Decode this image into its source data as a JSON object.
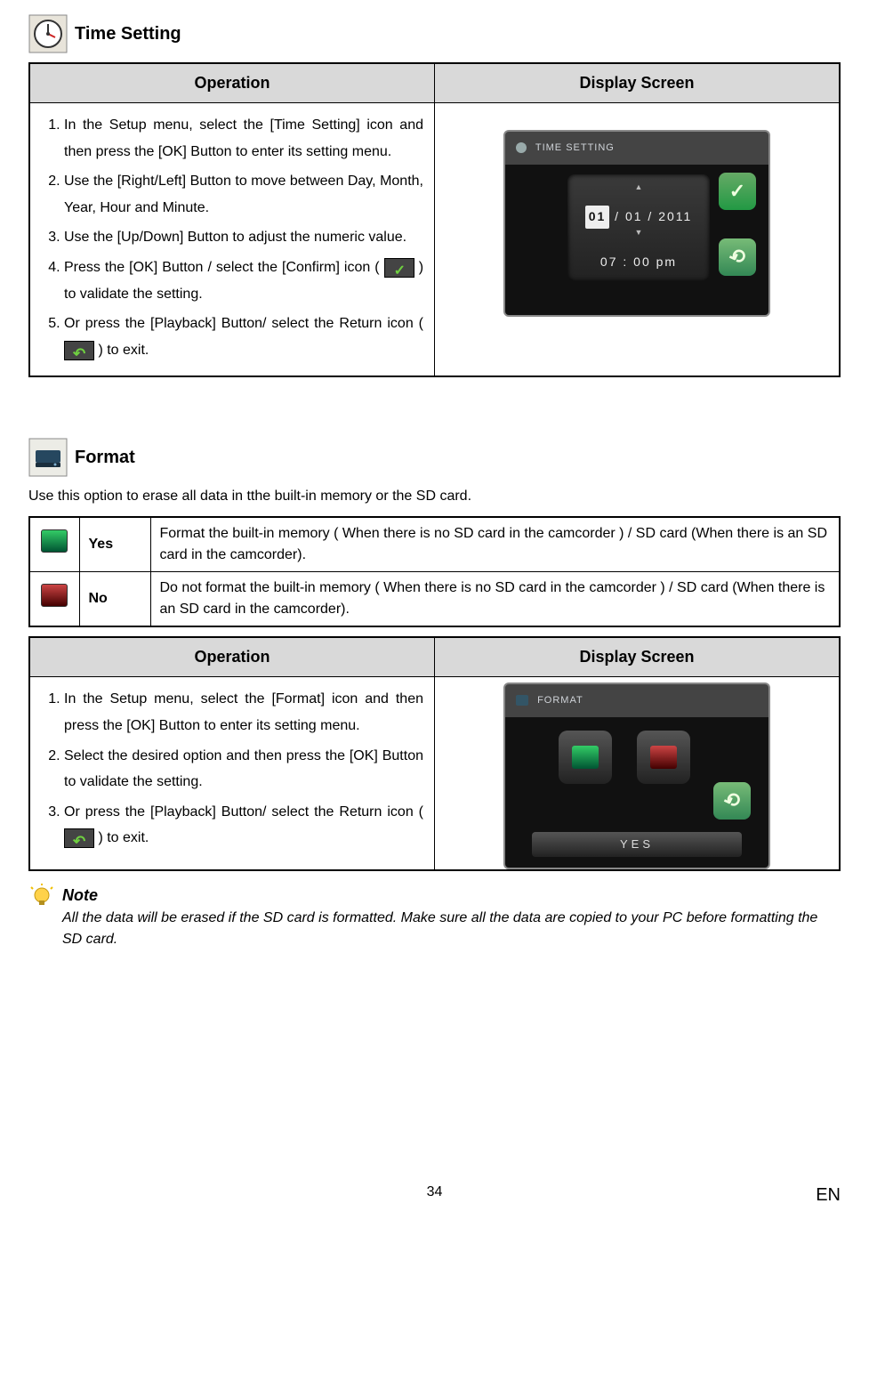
{
  "time_setting": {
    "heading": "Time Setting",
    "table": {
      "col_operation": "Operation",
      "col_display": "Display Screen",
      "steps": {
        "s1": "In the Setup menu, select the [Time Setting] icon and then press the [OK] Button to enter its setting menu.",
        "s2": "Use the [Right/Left] Button to move between Day, Month, Year, Hour and Minute.",
        "s3": "Use the [Up/Down] Button to adjust the numeric value.",
        "s4a": "Press the [OK] Button / select the [Confirm] icon (",
        "s4b": ") to validate the setting.",
        "s5a": "Or press the [Playback] Button/ select the Return icon (",
        "s5b": ") to exit."
      }
    },
    "screen": {
      "title": "TIME SETTING",
      "day": "01",
      "month": "01",
      "year": "2011",
      "hour": "07",
      "minute": "00",
      "ampm": "pm"
    }
  },
  "format": {
    "heading": "Format",
    "description": "Use this option to erase all data in tthe built-in memory or the SD card.",
    "options": {
      "yes_label": "Yes",
      "yes_desc": "Format the built-in memory ( When there is no SD card in the camcorder ) / SD card (When there is an SD card in the camcorder).",
      "no_label": "No",
      "no_desc": "Do not format the built-in memory ( When there is no SD card in the camcorder ) / SD card (When there is an SD card in the camcorder)."
    },
    "table": {
      "col_operation": "Operation",
      "col_display": "Display Screen",
      "steps": {
        "s1": "In the Setup menu, select the [Format] icon and then press the [OK] Button to enter its setting menu.",
        "s2": "Select the desired option and then press the [OK] Button to validate the setting.",
        "s3a": "Or press the [Playback] Button/ select the Return icon (",
        "s3b": ") to exit."
      }
    },
    "screen": {
      "title": "FORMAT",
      "bar": "YES"
    }
  },
  "note": {
    "title": "Note",
    "body": "All the data will be erased if the SD card is formatted. Make sure all the data are copied to your PC before formatting the SD card."
  },
  "footer": {
    "page": "34",
    "lang": "EN"
  }
}
